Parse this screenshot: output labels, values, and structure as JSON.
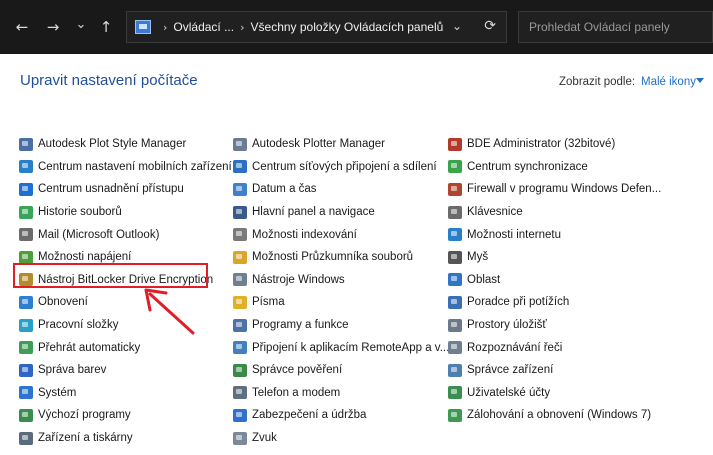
{
  "nav": {
    "back_icon": "←",
    "forward_icon": "→",
    "recent_icon": "⌄",
    "up_icon": "↑",
    "breadcrumb": [
      "Ovládací ...",
      "Všechny položky Ovládacích panelů"
    ],
    "sep": "›",
    "dropdown_icon": "⌄",
    "refresh_icon": "⟳",
    "search_placeholder": "Prohledat Ovládací panely"
  },
  "header": {
    "title": "Upravit nastavení počítače",
    "view_by_label": "Zobrazit podle:",
    "view_by_value": "Malé ikony"
  },
  "items": {
    "col1": [
      {
        "label": "Autodesk Plot Style Manager",
        "icon": "printer-icon",
        "color": "#4a6fa5"
      },
      {
        "label": "Centrum nastavení mobilních zařízení",
        "icon": "mobility-icon",
        "color": "#2a7fc9"
      },
      {
        "label": "Centrum usnadnění přístupu",
        "icon": "accessibility-icon",
        "color": "#1d6fd1"
      },
      {
        "label": "Historie souborů",
        "icon": "file-history-icon",
        "color": "#3aa55a"
      },
      {
        "label": "Mail (Microsoft Outlook)",
        "icon": "mail-icon",
        "color": "#6b6b6b"
      },
      {
        "label": "Možnosti napájení",
        "icon": "power-icon",
        "color": "#4e9e3a"
      },
      {
        "label": "Nástroj BitLocker Drive Encryption",
        "icon": "bitlocker-icon",
        "color": "#b38a2e"
      },
      {
        "label": "Obnovení",
        "icon": "recovery-icon",
        "color": "#2f7fd0"
      },
      {
        "label": "Pracovní složky",
        "icon": "work-folders-icon",
        "color": "#2aa0c9"
      },
      {
        "label": "Přehrát automaticky",
        "icon": "autoplay-icon",
        "color": "#3f9e56"
      },
      {
        "label": "Správa barev",
        "icon": "color-management-icon",
        "color": "#2f66c6"
      },
      {
        "label": "Systém",
        "icon": "system-icon",
        "color": "#2e74cf"
      },
      {
        "label": "Výchozí programy",
        "icon": "default-programs-icon",
        "color": "#3a8d4f"
      },
      {
        "label": "Zařízení a tiskárny",
        "icon": "devices-icon",
        "color": "#5a6b7c"
      }
    ],
    "col2": [
      {
        "label": "Autodesk Plotter Manager",
        "icon": "plotter-icon",
        "color": "#6a7c95"
      },
      {
        "label": "Centrum síťových připojení a sdílení",
        "icon": "network-icon",
        "color": "#2b6fc0"
      },
      {
        "label": "Datum a čas",
        "icon": "datetime-icon",
        "color": "#3f80cf"
      },
      {
        "label": "Hlavní panel a navigace",
        "icon": "taskbar-icon",
        "color": "#3a5a8c"
      },
      {
        "label": "Možnosti indexování",
        "icon": "indexing-icon",
        "color": "#7a7a7a"
      },
      {
        "label": "Možnosti Průzkumníka souborů",
        "icon": "folder-options-icon",
        "color": "#d9a52b"
      },
      {
        "label": "Nástroje Windows",
        "icon": "windows-tools-icon",
        "color": "#6f7f90"
      },
      {
        "label": "Písma",
        "icon": "fonts-icon",
        "color": "#e0b02a"
      },
      {
        "label": "Programy a funkce",
        "icon": "programs-icon",
        "color": "#4c73a8"
      },
      {
        "label": "Připojení k aplikacím RemoteApp a v...",
        "icon": "remoteapp-icon",
        "color": "#3f7fc2"
      },
      {
        "label": "Správce pověření",
        "icon": "credential-icon",
        "color": "#3b8a4a"
      },
      {
        "label": "Telefon a modem",
        "icon": "phone-icon",
        "color": "#5f6f82"
      },
      {
        "label": "Zabezpečení a údržba",
        "icon": "flag-icon",
        "color": "#2f6fd0"
      },
      {
        "label": "Zvuk",
        "icon": "sound-icon",
        "color": "#7b8a99"
      }
    ],
    "col3": [
      {
        "label": "BDE Administrator (32bitové)",
        "icon": "bde-icon",
        "color": "#b33a2a"
      },
      {
        "label": "Centrum synchronizace",
        "icon": "sync-icon",
        "color": "#3ba34a"
      },
      {
        "label": "Firewall v programu Windows Defen...",
        "icon": "firewall-icon",
        "color": "#b0452e"
      },
      {
        "label": "Klávesnice",
        "icon": "keyboard-icon",
        "color": "#6b6b6b"
      },
      {
        "label": "Možnosti internetu",
        "icon": "internet-icon",
        "color": "#2a7fc9"
      },
      {
        "label": "Myš",
        "icon": "mouse-icon",
        "color": "#555555"
      },
      {
        "label": "Oblast",
        "icon": "region-icon",
        "color": "#2f76c9"
      },
      {
        "label": "Poradce při potížích",
        "icon": "troubleshoot-icon",
        "color": "#3a6fb8"
      },
      {
        "label": "Prostory úložišť",
        "icon": "storage-icon",
        "color": "#6b7a8a"
      },
      {
        "label": "Rozpoznávání řeči",
        "icon": "speech-icon",
        "color": "#6f7f90"
      },
      {
        "label": "Správce zařízení",
        "icon": "device-manager-icon",
        "color": "#4e7fb0"
      },
      {
        "label": "Uživatelské účty",
        "icon": "user-accounts-icon",
        "color": "#3a8e4f"
      },
      {
        "label": "Zálohování a obnovení (Windows 7)",
        "icon": "backup-icon",
        "color": "#3c9a52"
      }
    ]
  }
}
